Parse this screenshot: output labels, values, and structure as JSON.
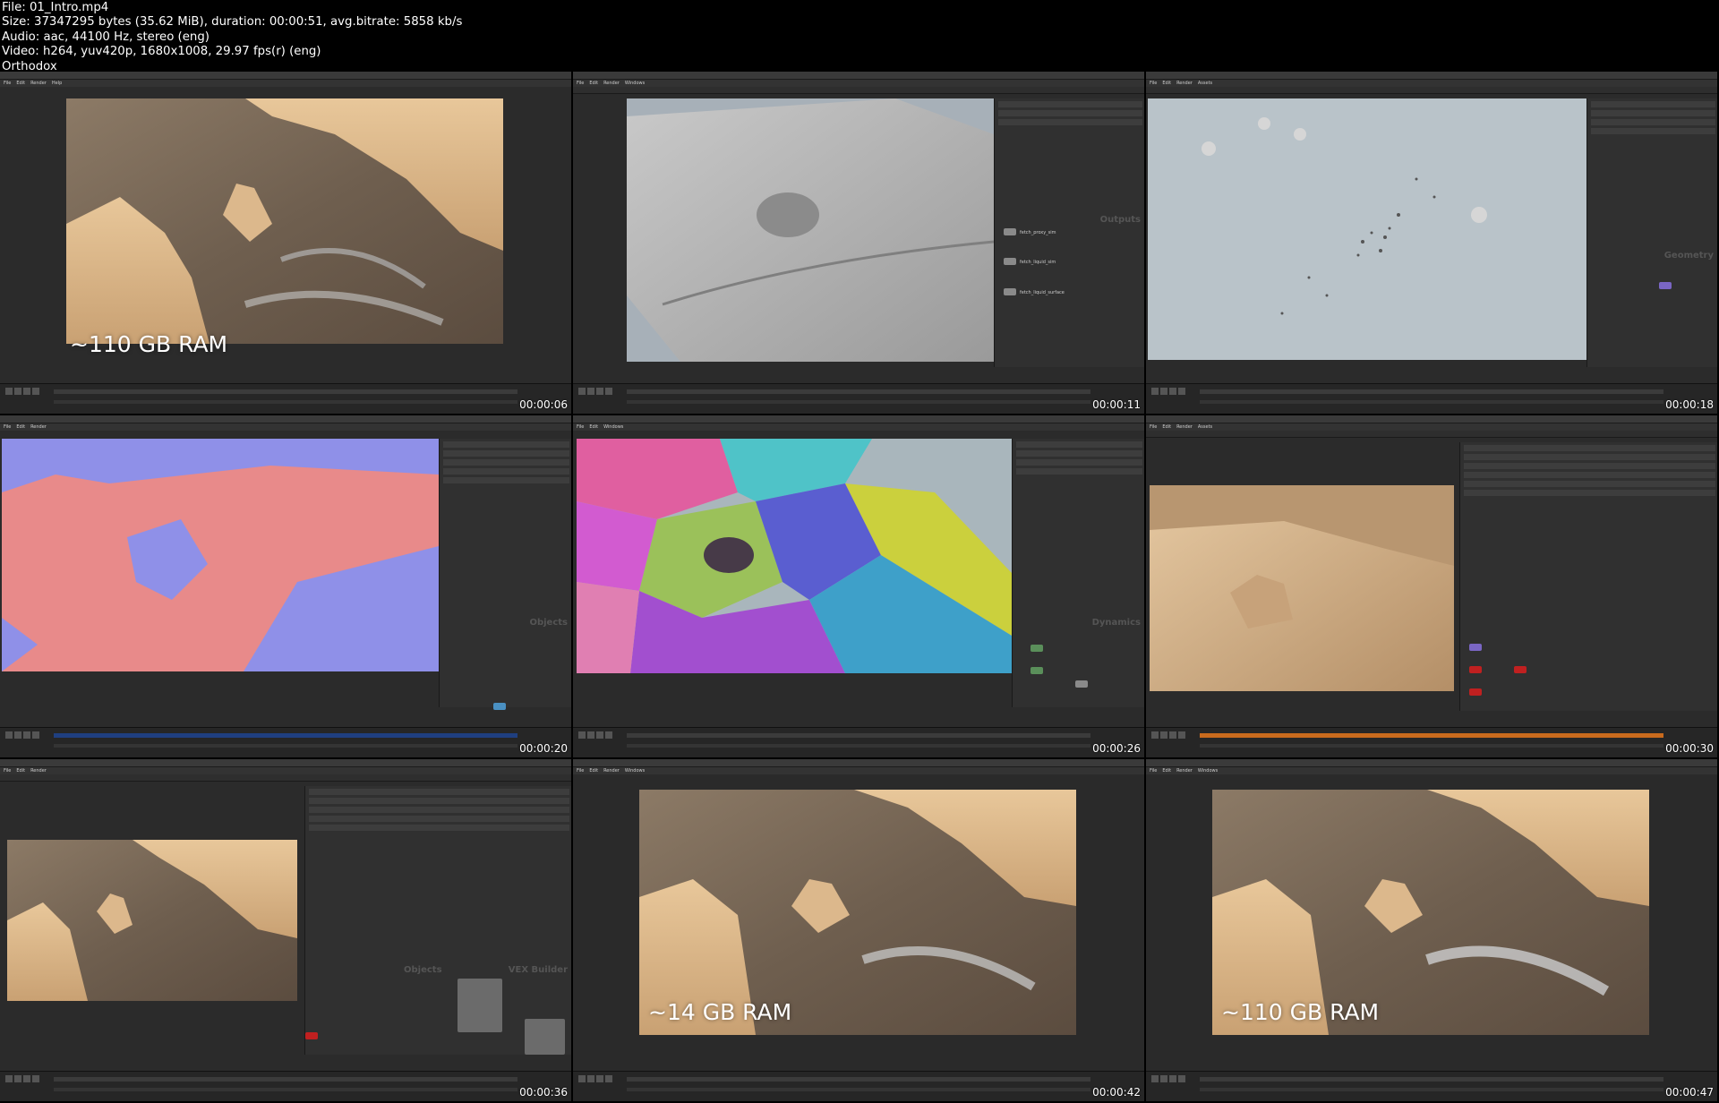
{
  "header": {
    "file": "File: 01_Intro.mp4",
    "size": "Size: 37347295 bytes (35.62 MiB), duration: 00:00:51, avg.bitrate: 5858 kb/s",
    "audio": "Audio: aac, 44100 Hz, stereo (eng)",
    "video": "Video: h264, yuv420p, 1680x1008, 29.97 fps(r) (eng)",
    "publisher": "Orthodox"
  },
  "tiles": [
    {
      "timestamp": "00:00:06",
      "overlay": "~110 GB RAM"
    },
    {
      "timestamp": "00:00:11"
    },
    {
      "timestamp": "00:00:18"
    },
    {
      "timestamp": "00:00:20"
    },
    {
      "timestamp": "00:00:26"
    },
    {
      "timestamp": "00:00:30"
    },
    {
      "timestamp": "00:00:36"
    },
    {
      "timestamp": "00:00:42",
      "overlay": "~14 GB RAM"
    },
    {
      "timestamp": "00:00:47",
      "overlay": "~110 GB RAM"
    }
  ],
  "network_labels": {
    "outputs": "Outputs",
    "geometry": "Geometry",
    "objects": "Objects",
    "dynamics": "Dynamics",
    "vex_builder": "VEX Builder"
  },
  "node_names": {
    "fetch_proxy_sim": "fetch_proxy_sim",
    "fetch_liquid_sim": "fetch_liquid_sim",
    "fetch_liquid_surface": "fetch_liquid_surface"
  },
  "menus": {
    "file": "File",
    "edit": "Edit",
    "render": "Render",
    "assets": "Assets",
    "windows": "Windows",
    "help": "Help"
  },
  "colors": {
    "sand": "#d8b285",
    "water": "#7c6b58",
    "particle_red": "#e88a8a",
    "particle_blue": "#8f90e8"
  }
}
